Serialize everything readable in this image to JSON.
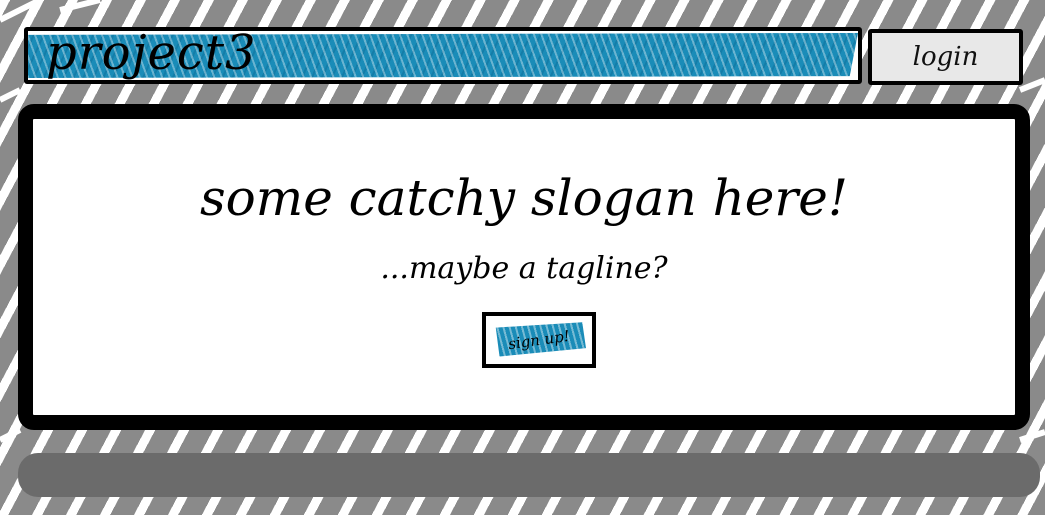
{
  "header": {
    "title": "project3",
    "login_label": "login"
  },
  "hero": {
    "slogan": "some catchy slogan here!",
    "tagline": "...maybe a tagline?",
    "signup_label": "sign up!"
  },
  "colors": {
    "accent": "#1a8cb8",
    "footer": "#6b6b6b",
    "background_gray": "#8a8a8a"
  }
}
